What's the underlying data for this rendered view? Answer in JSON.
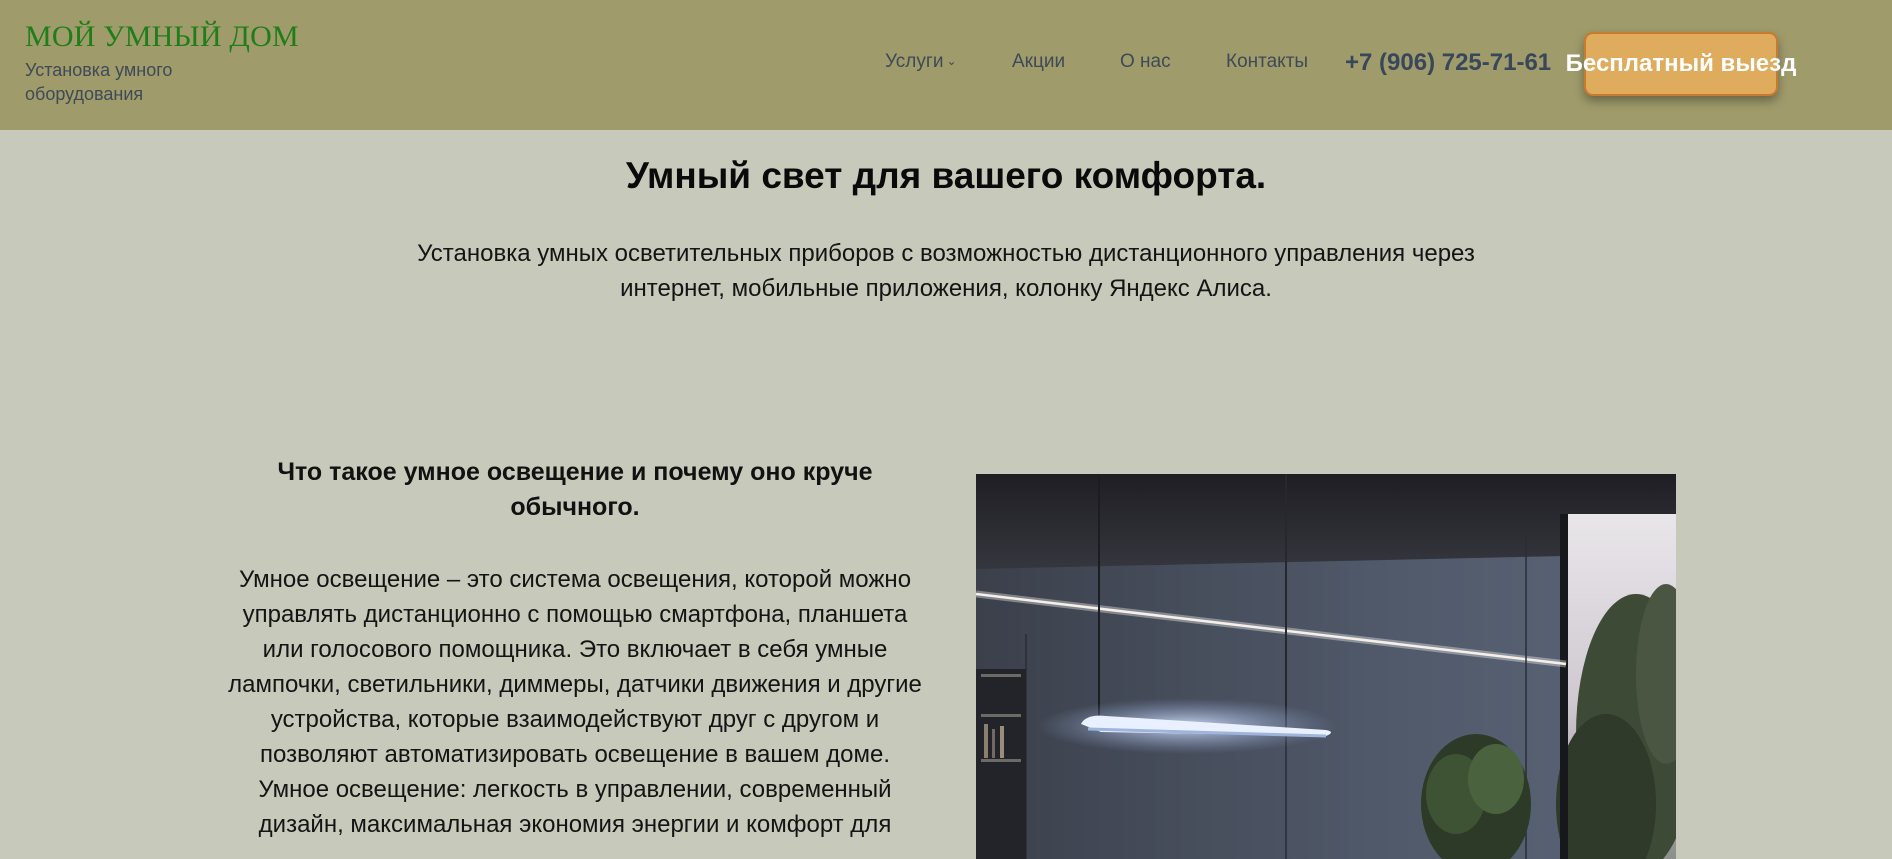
{
  "header": {
    "logo": "МОЙ УМНЫЙ ДОМ",
    "tagline": "Установка умного оборудования",
    "nav": {
      "services": "Услуги",
      "promos": "Акции",
      "about": "О нас",
      "contacts": "Контакты"
    },
    "services_chevron": "⌄",
    "phone": "+7 (906) 725-71-61",
    "cta": "Бесплатный выезд"
  },
  "hero": {
    "title": "Умный свет для вашего комфорта.",
    "subtitle": "Установка умных осветительных приборов с возможностью дистанционного управления через интернет, мобильные приложения, колонку Яндекс Алиса."
  },
  "section": {
    "title": "Что такое умное освещение и почему оно круче обычного.",
    "paragraph1": "Умное освещение – это система освещения, которой можно управлять дистанционно с помощью смартфона, планшета или голосового помощника. Это включает в себя умные лампочки, светильники, диммеры, датчики движения и другие устройства, которые взаимодействуют друг с другом и позволяют автоматизировать освещение в вашем доме.",
    "paragraph2": "Умное освещение: легкость в управлении, современный дизайн, максимальная экономия энергии и комфорт для"
  },
  "colors": {
    "header_bg": "#a09b6b",
    "page_bg": "#c7c9bb",
    "logo": "#1f7d1a",
    "cta_bg": "#dfab5c",
    "cta_border": "#c77b2e",
    "nav_text": "#3e4a56"
  }
}
